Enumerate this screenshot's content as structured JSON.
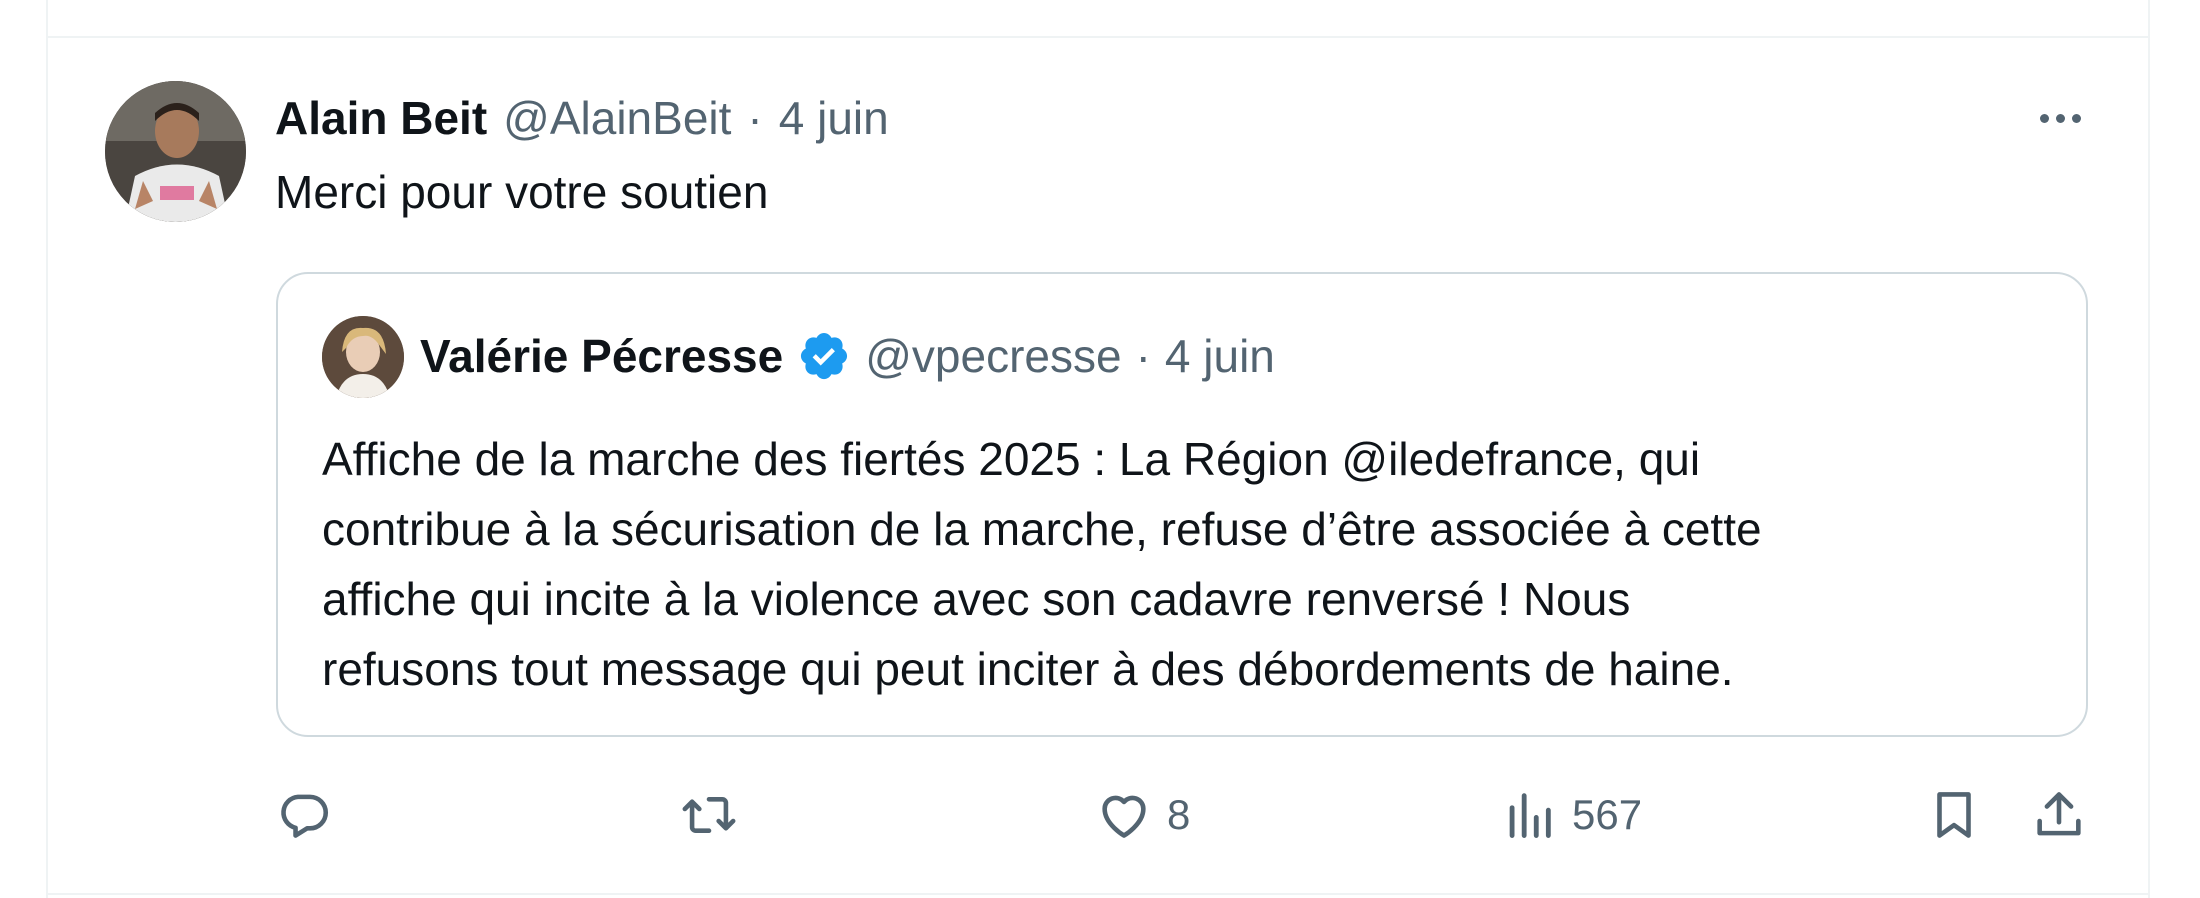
{
  "tweet": {
    "author_name": "Alain Beit",
    "author_handle": "@AlainBeit",
    "separator": "·",
    "date": "4 juin",
    "text": "Merci pour votre soutien",
    "more_icon": "more-icon"
  },
  "quote": {
    "author_name": "Valérie Pécresse",
    "verified_icon": "verified-badge-icon",
    "author_handle": "@vpecresse",
    "separator": "·",
    "date": "4 juin",
    "lines": [
      "Affiche de la marche des fiertés 2025 : La Région @iledefrance, qui",
      "contribue à la sécurisation de la marche, refuse d’être associée à cette",
      "affiche qui incite à la violence avec son cadavre renversé ! Nous",
      "refusons tout message qui peut inciter à des débordements de haine."
    ]
  },
  "actions": {
    "reply_icon": "reply-icon",
    "retweet_icon": "retweet-icon",
    "like_icon": "heart-icon",
    "like_count": "8",
    "views_icon": "views-icon",
    "views_count": "567",
    "bookmark_icon": "bookmark-icon",
    "share_icon": "share-icon"
  },
  "colors": {
    "text": "#0f1419",
    "muted": "#536471",
    "border": "#cfd9de",
    "verified": "#1d9bf0"
  }
}
